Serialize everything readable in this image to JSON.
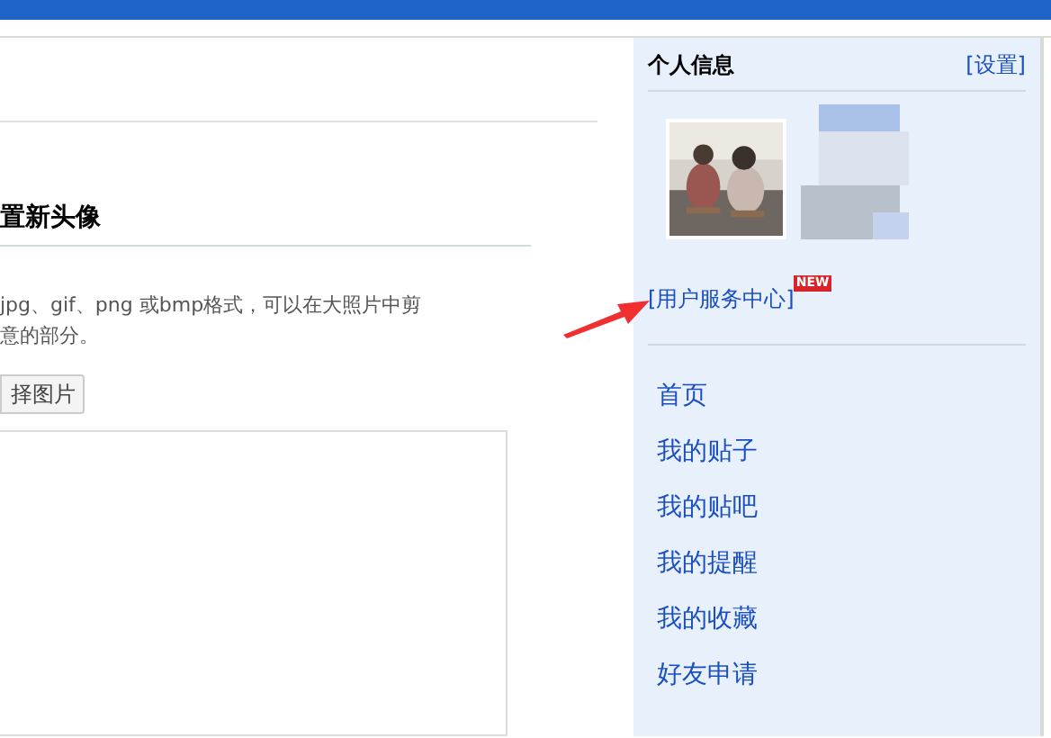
{
  "upload": {
    "heading": "置新头像",
    "description_lines": [
      "jpg、gif、png 或bmp格式，可以在大照片中剪",
      "意的部分。"
    ],
    "button": "择图片"
  },
  "profile": {
    "title": "个人信息",
    "settings_link": "[设置]",
    "service_link": "[用户服务中心]",
    "badge": "NEW"
  },
  "menu": [
    {
      "label": "首页"
    },
    {
      "label": "我的贴子"
    },
    {
      "label": "我的贴吧"
    },
    {
      "label": "我的提醒"
    },
    {
      "label": "我的收藏"
    },
    {
      "label": "好友申请"
    }
  ]
}
